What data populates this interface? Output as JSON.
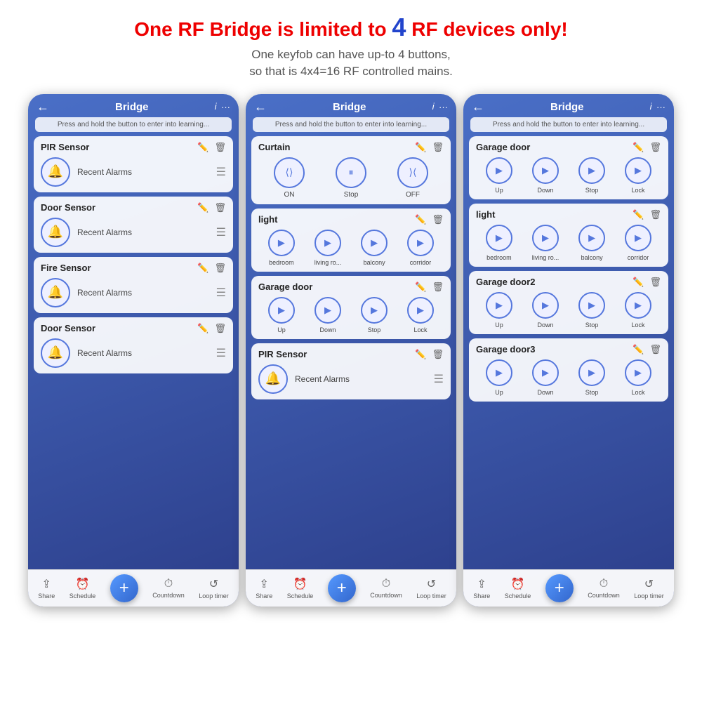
{
  "header": {
    "line1_pre": "One RF Bridge is limited to ",
    "line1_num": "4",
    "line1_post": " RF devices only!",
    "line2": "One keyfob can have up-to 4 buttons,",
    "line3": "so that is 4x4=16 RF controlled mains."
  },
  "phones": [
    {
      "id": "phone1",
      "title": "Bridge",
      "instruction": "Press and hold the button to enter into learning...",
      "devices": [
        {
          "type": "sensor",
          "name": "PIR Sensor",
          "label": "Recent Alarms"
        },
        {
          "type": "sensor",
          "name": "Door Sensor",
          "label": "Recent Alarms"
        },
        {
          "type": "sensor",
          "name": "Fire Sensor",
          "label": "Recent Alarms"
        },
        {
          "type": "sensor",
          "name": "Door Sensor",
          "label": "Recent Alarms"
        }
      ],
      "bottom": [
        "Share",
        "Schedule",
        "",
        "Countdown",
        "Loop timer"
      ]
    },
    {
      "id": "phone2",
      "title": "Bridge",
      "instruction": "Press and hold the button to enter into learning...",
      "devices": [
        {
          "type": "curtain",
          "name": "Curtain",
          "controls": [
            {
              "icon": "⟨⟩",
              "label": "ON"
            },
            {
              "icon": "⏸",
              "label": "Stop"
            },
            {
              "icon": "⟩⟨",
              "label": "OFF"
            }
          ]
        },
        {
          "type": "four",
          "name": "light",
          "buttons": [
            {
              "icon": "▶",
              "label": "bedroom"
            },
            {
              "icon": "▶",
              "label": "living ro..."
            },
            {
              "icon": "▶",
              "label": "balcony"
            },
            {
              "icon": "▶",
              "label": "corridor"
            }
          ]
        },
        {
          "type": "four",
          "name": "Garage door",
          "buttons": [
            {
              "icon": "▶",
              "label": "Up"
            },
            {
              "icon": "▶",
              "label": "Down"
            },
            {
              "icon": "▶",
              "label": "Stop"
            },
            {
              "icon": "▶",
              "label": "Lock"
            }
          ]
        },
        {
          "type": "sensor",
          "name": "PIR Sensor",
          "label": "Recent Alarms"
        }
      ],
      "bottom": [
        "Share",
        "Schedule",
        "",
        "Countdown",
        "Loop timer"
      ]
    },
    {
      "id": "phone3",
      "title": "Bridge",
      "instruction": "Press and hold the button to enter into learning...",
      "devices": [
        {
          "type": "four",
          "name": "Garage door",
          "buttons": [
            {
              "icon": "▶",
              "label": "Up"
            },
            {
              "icon": "▶",
              "label": "Down"
            },
            {
              "icon": "▶",
              "label": "Stop"
            },
            {
              "icon": "▶",
              "label": "Lock"
            }
          ]
        },
        {
          "type": "four",
          "name": "light",
          "buttons": [
            {
              "icon": "▶",
              "label": "bedroom"
            },
            {
              "icon": "▶",
              "label": "living ro..."
            },
            {
              "icon": "▶",
              "label": "balcony"
            },
            {
              "icon": "▶",
              "label": "corridor"
            }
          ]
        },
        {
          "type": "four",
          "name": "Garage door2",
          "buttons": [
            {
              "icon": "▶",
              "label": "Up"
            },
            {
              "icon": "▶",
              "label": "Down"
            },
            {
              "icon": "▶",
              "label": "Stop"
            },
            {
              "icon": "▶",
              "label": "Lock"
            }
          ]
        },
        {
          "type": "four",
          "name": "Garage door3",
          "buttons": [
            {
              "icon": "▶",
              "label": "Up"
            },
            {
              "icon": "▶",
              "label": "Down"
            },
            {
              "icon": "▶",
              "label": "Stop"
            },
            {
              "icon": "▶",
              "label": "Lock"
            }
          ]
        }
      ],
      "bottom": [
        "Share",
        "Schedule",
        "",
        "Countdown",
        "Loop timer"
      ]
    }
  ]
}
